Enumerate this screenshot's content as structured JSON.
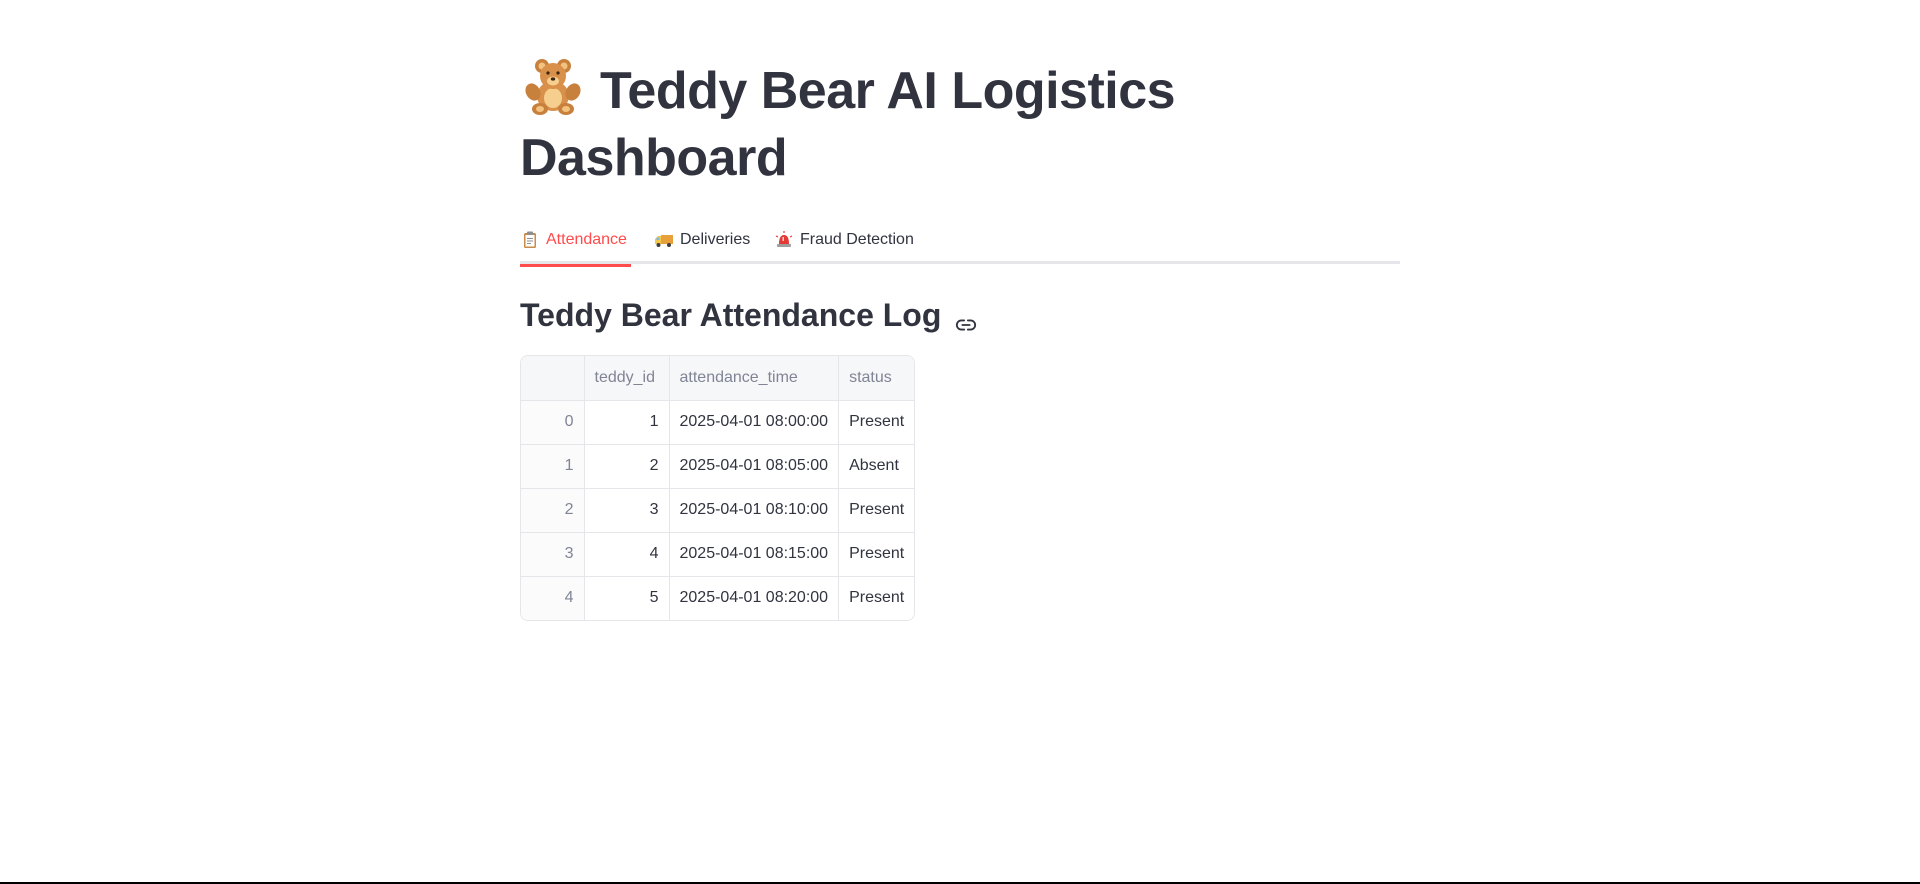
{
  "page": {
    "title_text": "Teddy Bear AI Logistics Dashboard",
    "title_icon": "teddy-bear-icon"
  },
  "tabs": [
    {
      "label": "Attendance",
      "icon": "clipboard-icon",
      "active": true
    },
    {
      "label": "Deliveries",
      "icon": "delivery-truck-icon",
      "active": false
    },
    {
      "label": "Fraud Detection",
      "icon": "police-light-icon",
      "active": false
    }
  ],
  "section": {
    "heading": "Teddy Bear Attendance Log",
    "anchor_icon": "link-icon"
  },
  "table": {
    "columns": [
      "",
      "teddy_id",
      "attendance_time",
      "status"
    ],
    "rows": [
      {
        "index": "0",
        "teddy_id": "1",
        "attendance_time": "2025-04-01 08:00:00",
        "status": "Present"
      },
      {
        "index": "1",
        "teddy_id": "2",
        "attendance_time": "2025-04-01 08:05:00",
        "status": "Absent"
      },
      {
        "index": "2",
        "teddy_id": "3",
        "attendance_time": "2025-04-01 08:10:00",
        "status": "Present"
      },
      {
        "index": "3",
        "teddy_id": "4",
        "attendance_time": "2025-04-01 08:15:00",
        "status": "Present"
      },
      {
        "index": "4",
        "teddy_id": "5",
        "attendance_time": "2025-04-01 08:20:00",
        "status": "Present"
      }
    ]
  },
  "colors": {
    "accent": "#ff4b4b",
    "text": "#31333f",
    "muted": "#808495",
    "border": "#e6e6ea"
  }
}
